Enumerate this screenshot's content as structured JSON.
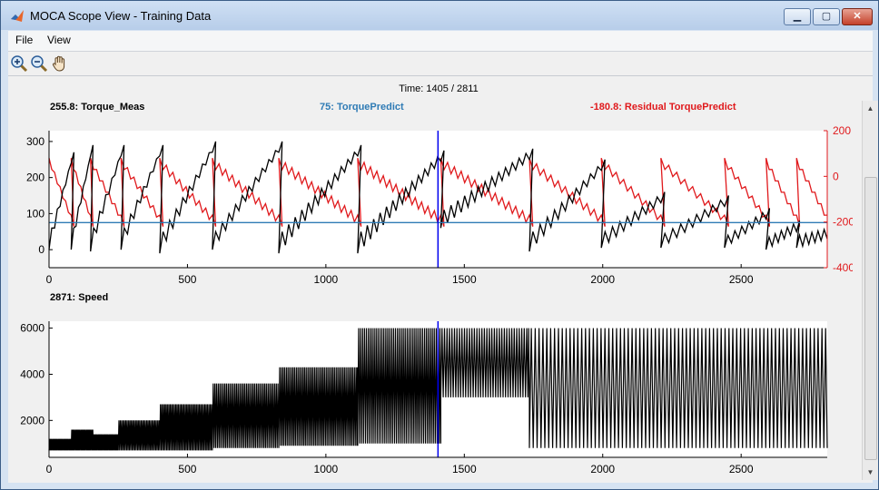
{
  "window": {
    "title": "MOCA Scope View - Training Data"
  },
  "menu": [
    "File",
    "View"
  ],
  "toolbar": [
    {
      "name": "zoom-in-icon"
    },
    {
      "name": "zoom-out-icon"
    },
    {
      "name": "pan-hand-icon"
    }
  ],
  "time_label": "Time: 1405 / 2811",
  "chart_data": [
    {
      "type": "line",
      "x_range": [
        0,
        2811
      ],
      "cursor_x": 1405,
      "x_ticks": [
        0,
        500,
        1000,
        1500,
        2000,
        2500
      ],
      "ylim_left": [
        -50,
        330
      ],
      "y_ticks_left": [
        0,
        100,
        200,
        300
      ],
      "ylim_right": [
        -400,
        200
      ],
      "y_ticks_right": [
        -400,
        -200,
        0,
        200
      ],
      "series": [
        {
          "name": "Torque_Meas",
          "readout": "255.8: Torque_Meas",
          "color": "#000000",
          "axis": "left"
        },
        {
          "name": "TorquePredict",
          "readout": "75: TorquePredict",
          "color": "#2f7bb5",
          "axis": "left",
          "constant": 75
        },
        {
          "name": "Residual TorquePredict",
          "readout": "-180.8: Residual TorquePredict",
          "color": "#e0191c",
          "axis": "right"
        }
      ],
      "segments": [
        {
          "start": 0,
          "end": 80,
          "base_lo": 0,
          "base_hi": 60,
          "peak": 270,
          "teeth": 4
        },
        {
          "start": 80,
          "end": 150,
          "base_lo": 0,
          "base_hi": 60,
          "peak": 290,
          "teeth": 4
        },
        {
          "start": 150,
          "end": 260,
          "base_lo": -5,
          "base_hi": 60,
          "peak": 290,
          "teeth": 5
        },
        {
          "start": 260,
          "end": 400,
          "base_lo": 0,
          "base_hi": 60,
          "peak": 290,
          "teeth": 6
        },
        {
          "start": 400,
          "end": 590,
          "base_lo": -10,
          "base_hi": 50,
          "peak": 300,
          "teeth": 8
        },
        {
          "start": 590,
          "end": 830,
          "base_lo": 0,
          "base_hi": 50,
          "peak": 300,
          "teeth": 10
        },
        {
          "start": 830,
          "end": 1115,
          "base_lo": -10,
          "base_hi": 50,
          "peak": 290,
          "teeth": 12
        },
        {
          "start": 1115,
          "end": 1415,
          "base_lo": -10,
          "base_hi": 50,
          "peak": 275,
          "teeth": 13
        },
        {
          "start": 1415,
          "end": 1735,
          "base_lo": 60,
          "base_hi": 110,
          "peak": 280,
          "teeth": 13
        },
        {
          "start": 1735,
          "end": 1995,
          "base_lo": -5,
          "base_hi": 50,
          "peak": 250,
          "teeth": 10
        },
        {
          "start": 1995,
          "end": 2210,
          "base_lo": 5,
          "base_hi": 50,
          "peak": 160,
          "teeth": 8
        },
        {
          "start": 2210,
          "end": 2440,
          "base_lo": 5,
          "base_hi": 45,
          "peak": 150,
          "teeth": 8
        },
        {
          "start": 2440,
          "end": 2590,
          "base_lo": 5,
          "base_hi": 40,
          "peak": 115,
          "teeth": 6
        },
        {
          "start": 2590,
          "end": 2700,
          "base_lo": 0,
          "base_hi": 35,
          "peak": 80,
          "teeth": 5
        },
        {
          "start": 2700,
          "end": 2811,
          "base_lo": 5,
          "base_hi": 40,
          "peak": 60,
          "teeth": 5
        }
      ]
    },
    {
      "type": "line",
      "readout": "2871: Speed",
      "x_range": [
        0,
        2811
      ],
      "cursor_x": 1405,
      "x_ticks": [
        0,
        500,
        1000,
        1500,
        2000,
        2500
      ],
      "ylim": [
        400,
        6300
      ],
      "y_ticks": [
        2000,
        4000,
        6000
      ],
      "series": [
        {
          "name": "Speed",
          "color": "#000000"
        }
      ],
      "blocks": [
        {
          "start": 0,
          "end": 80,
          "lo": 700,
          "hi": 1200,
          "period": 4
        },
        {
          "start": 80,
          "end": 160,
          "lo": 700,
          "hi": 1600,
          "period": 4
        },
        {
          "start": 160,
          "end": 250,
          "lo": 700,
          "hi": 1400,
          "period": 4
        },
        {
          "start": 250,
          "end": 400,
          "lo": 700,
          "hi": 2000,
          "period": 5
        },
        {
          "start": 400,
          "end": 590,
          "lo": 700,
          "hi": 2700,
          "period": 5
        },
        {
          "start": 590,
          "end": 830,
          "lo": 800,
          "hi": 3600,
          "period": 6
        },
        {
          "start": 830,
          "end": 1115,
          "lo": 900,
          "hi": 4300,
          "period": 6
        },
        {
          "start": 1115,
          "end": 1415,
          "lo": 1000,
          "hi": 6000,
          "period": 7
        },
        {
          "start": 1415,
          "end": 1735,
          "lo": 3000,
          "hi": 6000,
          "period": 9
        },
        {
          "start": 1735,
          "end": 2811,
          "lo": 800,
          "hi": 6000,
          "period": 14
        }
      ]
    }
  ]
}
